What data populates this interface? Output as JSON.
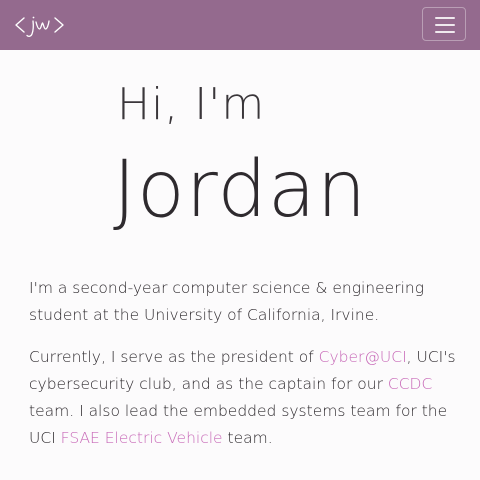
{
  "colors": {
    "navbar_bg": "#946a8e",
    "link": "#c86ab8",
    "text": "#2e2a2e",
    "page_bg": "#fcfbfc"
  },
  "navbar": {
    "logo_text": "<jw>",
    "toggler_icon": "hamburger-icon"
  },
  "hero": {
    "greeting": "Hi, I'm",
    "name": "Jordan"
  },
  "bio": {
    "p1": "I'm a second-year computer science & engineering student at the University of California, Irvine.",
    "p2_a": "Currently, I serve as the president of ",
    "p2_link1": "Cyber@UCI",
    "p2_b": ", UCI's cybersecurity club, and as the captain for our ",
    "p2_link2": "CCDC",
    "p2_c": " team. I also lead the embedded systems team for the UCI ",
    "p2_link3": "FSAE Electric Vehicle",
    "p2_d": " team."
  }
}
